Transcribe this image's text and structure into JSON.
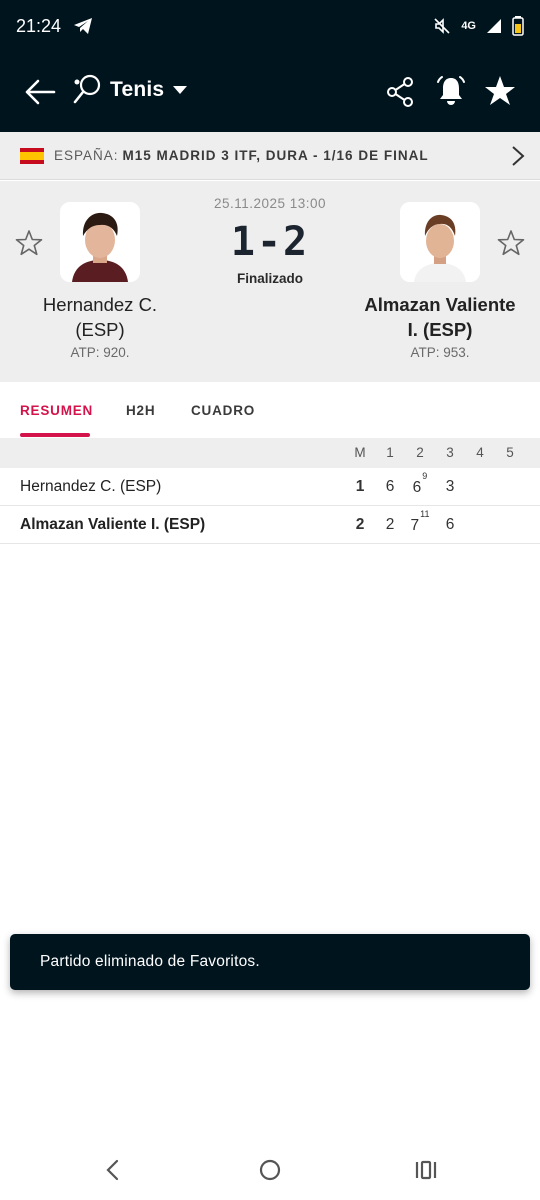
{
  "status_bar": {
    "time": "21:24",
    "network": "4G",
    "icons": [
      "telegram-icon",
      "mute-icon",
      "signal-icon",
      "battery-icon"
    ]
  },
  "app_bar": {
    "sport": "Tenis",
    "icons": [
      "back-arrow-icon",
      "tennis-racket-icon",
      "dropdown-caret-icon",
      "share-icon",
      "alarm-bell-icon",
      "star-filled-icon"
    ]
  },
  "league": {
    "country": "ESPAÑA:",
    "tournament": "M15 MADRID 3 ITF, DURA - 1/16 DE FINAL",
    "flag": "spain-flag"
  },
  "match": {
    "datetime": "25.11.2025 13:00",
    "score": "1-2",
    "status": "Finalizado",
    "home": {
      "name_line1": "Hernandez C.",
      "name_line2": "(ESP)",
      "rank": "ATP: 920."
    },
    "away": {
      "name_line1": "Almazan Valiente",
      "name_line2": "I. (ESP)",
      "rank": "ATP: 953."
    }
  },
  "tabs": [
    {
      "label": "RESUMEN",
      "active": true
    },
    {
      "label": "H2H",
      "active": false
    },
    {
      "label": "CUADRO",
      "active": false
    }
  ],
  "score_table": {
    "columns": [
      "M",
      "1",
      "2",
      "3",
      "4",
      "5"
    ],
    "rows": [
      {
        "player": "Hernandez C. (ESP)",
        "m": "1",
        "s1": "6",
        "s2": "6",
        "s2_tb": "9",
        "s3": "3",
        "s4": "",
        "s5": ""
      },
      {
        "player": "Almazan Valiente I. (ESP)",
        "m": "2",
        "s1": "2",
        "s2": "7",
        "s2_tb": "11",
        "s3": "6",
        "s4": "",
        "s5": ""
      }
    ]
  },
  "toast": {
    "message": "Partido eliminado de Favoritos."
  },
  "colors": {
    "header_bg": "#00141e",
    "accent": "#d4134a",
    "panel_bg": "#eeeeee"
  }
}
